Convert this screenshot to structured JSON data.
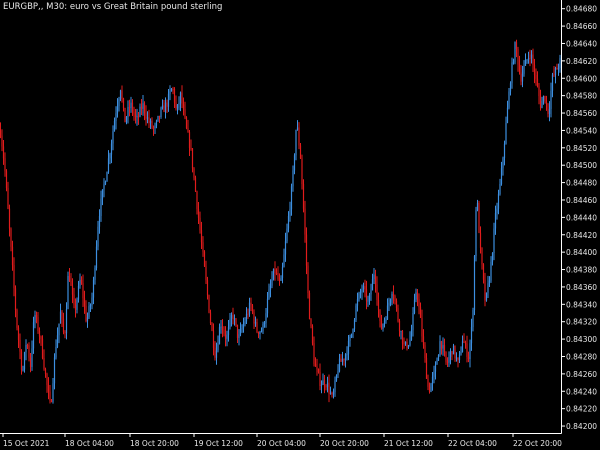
{
  "chart_data": {
    "type": "candlestick",
    "title": "EURGBP,, M30:  euro vs Great Britain pound sterling",
    "symbol": "EURGBP",
    "timeframe": "M30",
    "x_tick_labels": [
      "15 Oct 2021",
      "18 Oct 04:00",
      "18 Oct 20:00",
      "19 Oct 12:00",
      "20 Oct 04:00",
      "20 Oct 20:00",
      "21 Oct 12:00",
      "22 Oct 04:00",
      "22 Oct 20:00"
    ],
    "y_tick_labels": [
      "0.84680",
      "0.84660",
      "0.84640",
      "0.84620",
      "0.84600",
      "0.84580",
      "0.84560",
      "0.84540",
      "0.84520",
      "0.84500",
      "0.84480",
      "0.84460",
      "0.84440",
      "0.84420",
      "0.84400",
      "0.84380",
      "0.84360",
      "0.84340",
      "0.84320",
      "0.84300",
      "0.84280",
      "0.84260",
      "0.84240",
      "0.84220",
      "0.84200"
    ],
    "ylim": [
      0.84192,
      0.8469
    ],
    "colors": {
      "bull": "#3d8fe0",
      "bear": "#e01c1c",
      "background": "#000000",
      "axis": "#ffffff",
      "text": "#e8e8e8"
    },
    "close_path": [
      [
        0,
        0.8454
      ],
      [
        4,
        0.845
      ],
      [
        8,
        0.8444
      ],
      [
        12,
        0.8438
      ],
      [
        16,
        0.8432
      ],
      [
        22,
        0.8426
      ],
      [
        26,
        0.843
      ],
      [
        30,
        0.8427
      ],
      [
        34,
        0.8433
      ],
      [
        40,
        0.843
      ],
      [
        46,
        0.8425
      ],
      [
        50,
        0.8422
      ],
      [
        55,
        0.8429
      ],
      [
        60,
        0.8433
      ],
      [
        64,
        0.843
      ],
      [
        68,
        0.8438
      ],
      [
        74,
        0.8433
      ],
      [
        80,
        0.8437
      ],
      [
        86,
        0.8432
      ],
      [
        92,
        0.8435
      ],
      [
        98,
        0.8444
      ],
      [
        104,
        0.8448
      ],
      [
        110,
        0.8452
      ],
      [
        115,
        0.8456
      ],
      [
        120,
        0.8459
      ],
      [
        124,
        0.8455
      ],
      [
        130,
        0.8457
      ],
      [
        136,
        0.8455
      ],
      [
        142,
        0.8457
      ],
      [
        148,
        0.8455
      ],
      [
        154,
        0.8454
      ],
      [
        160,
        0.8456
      ],
      [
        166,
        0.8457
      ],
      [
        172,
        0.8459
      ],
      [
        176,
        0.8456
      ],
      [
        180,
        0.8458
      ],
      [
        186,
        0.8454
      ],
      [
        190,
        0.8452
      ],
      [
        195,
        0.8447
      ],
      [
        200,
        0.8442
      ],
      [
        205,
        0.8437
      ],
      [
        210,
        0.8432
      ],
      [
        215,
        0.8428
      ],
      [
        220,
        0.8432
      ],
      [
        226,
        0.843
      ],
      [
        232,
        0.8433
      ],
      [
        238,
        0.843
      ],
      [
        244,
        0.8432
      ],
      [
        250,
        0.8434
      ],
      [
        256,
        0.8431
      ],
      [
        262,
        0.8431
      ],
      [
        268,
        0.8435
      ],
      [
        274,
        0.8438
      ],
      [
        280,
        0.8436
      ],
      [
        286,
        0.8442
      ],
      [
        292,
        0.8448
      ],
      [
        296,
        0.8455
      ],
      [
        300,
        0.8451
      ],
      [
        304,
        0.8443
      ],
      [
        308,
        0.8434
      ],
      [
        314,
        0.8427
      ],
      [
        320,
        0.8425
      ],
      [
        326,
        0.8425
      ],
      [
        332,
        0.8423
      ],
      [
        338,
        0.8427
      ],
      [
        344,
        0.8428
      ],
      [
        350,
        0.843
      ],
      [
        356,
        0.8434
      ],
      [
        362,
        0.8436
      ],
      [
        368,
        0.8434
      ],
      [
        374,
        0.8438
      ],
      [
        380,
        0.8431
      ],
      [
        386,
        0.8433
      ],
      [
        392,
        0.8436
      ],
      [
        398,
        0.8432
      ],
      [
        404,
        0.8429
      ],
      [
        410,
        0.843
      ],
      [
        416,
        0.8436
      ],
      [
        422,
        0.843
      ],
      [
        428,
        0.8424
      ],
      [
        434,
        0.8426
      ],
      [
        440,
        0.843
      ],
      [
        446,
        0.8427
      ],
      [
        452,
        0.8429
      ],
      [
        458,
        0.8427
      ],
      [
        462,
        0.843
      ],
      [
        468,
        0.8428
      ],
      [
        472,
        0.8432
      ],
      [
        476,
        0.8447
      ],
      [
        480,
        0.844
      ],
      [
        485,
        0.8434
      ],
      [
        490,
        0.8438
      ],
      [
        495,
        0.8444
      ],
      [
        500,
        0.8448
      ],
      [
        505,
        0.8454
      ],
      [
        510,
        0.846
      ],
      [
        515,
        0.8464
      ],
      [
        520,
        0.846
      ],
      [
        526,
        0.8462
      ],
      [
        530,
        0.8463
      ],
      [
        535,
        0.846
      ],
      [
        540,
        0.8457
      ],
      [
        544,
        0.8458
      ],
      [
        548,
        0.8456
      ],
      [
        552,
        0.846
      ],
      [
        556,
        0.8461
      ],
      [
        560,
        0.8462
      ]
    ]
  }
}
